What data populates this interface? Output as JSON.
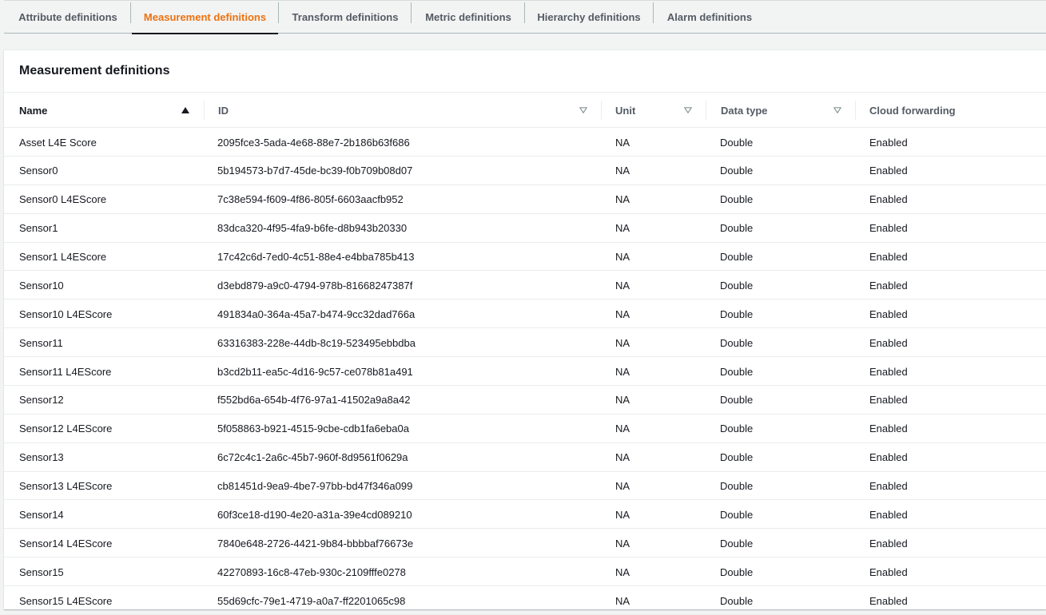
{
  "tabs": [
    {
      "label": "Attribute definitions",
      "active": false
    },
    {
      "label": "Measurement definitions",
      "active": true
    },
    {
      "label": "Transform definitions",
      "active": false
    },
    {
      "label": "Metric definitions",
      "active": false
    },
    {
      "label": "Hierarchy definitions",
      "active": false
    },
    {
      "label": "Alarm definitions",
      "active": false
    }
  ],
  "panel": {
    "title": "Measurement definitions"
  },
  "table": {
    "columns": {
      "name": "Name",
      "id": "ID",
      "unit": "Unit",
      "data_type": "Data type",
      "cloud_forwarding": "Cloud forwarding"
    },
    "sort": {
      "column": "name",
      "direction": "ascending"
    },
    "rows": [
      {
        "name": "Asset L4E Score",
        "id": "2095fce3-5ada-4e68-88e7-2b186b63f686",
        "unit": "NA",
        "data_type": "Double",
        "cloud_forwarding": "Enabled"
      },
      {
        "name": "Sensor0",
        "id": "5b194573-b7d7-45de-bc39-f0b709b08d07",
        "unit": "NA",
        "data_type": "Double",
        "cloud_forwarding": "Enabled"
      },
      {
        "name": "Sensor0 L4EScore",
        "id": "7c38e594-f609-4f86-805f-6603aacfb952",
        "unit": "NA",
        "data_type": "Double",
        "cloud_forwarding": "Enabled"
      },
      {
        "name": "Sensor1",
        "id": "83dca320-4f95-4fa9-b6fe-d8b943b20330",
        "unit": "NA",
        "data_type": "Double",
        "cloud_forwarding": "Enabled"
      },
      {
        "name": "Sensor1 L4EScore",
        "id": "17c42c6d-7ed0-4c51-88e4-e4bba785b413",
        "unit": "NA",
        "data_type": "Double",
        "cloud_forwarding": "Enabled"
      },
      {
        "name": "Sensor10",
        "id": "d3ebd879-a9c0-4794-978b-81668247387f",
        "unit": "NA",
        "data_type": "Double",
        "cloud_forwarding": "Enabled"
      },
      {
        "name": "Sensor10 L4EScore",
        "id": "491834a0-364a-45a7-b474-9cc32dad766a",
        "unit": "NA",
        "data_type": "Double",
        "cloud_forwarding": "Enabled"
      },
      {
        "name": "Sensor11",
        "id": "63316383-228e-44db-8c19-523495ebbdba",
        "unit": "NA",
        "data_type": "Double",
        "cloud_forwarding": "Enabled"
      },
      {
        "name": "Sensor11 L4EScore",
        "id": "b3cd2b11-ea5c-4d16-9c57-ce078b81a491",
        "unit": "NA",
        "data_type": "Double",
        "cloud_forwarding": "Enabled"
      },
      {
        "name": "Sensor12",
        "id": "f552bd6a-654b-4f76-97a1-41502a9a8a42",
        "unit": "NA",
        "data_type": "Double",
        "cloud_forwarding": "Enabled"
      },
      {
        "name": "Sensor12 L4EScore",
        "id": "5f058863-b921-4515-9cbe-cdb1fa6eba0a",
        "unit": "NA",
        "data_type": "Double",
        "cloud_forwarding": "Enabled"
      },
      {
        "name": "Sensor13",
        "id": "6c72c4c1-2a6c-45b7-960f-8d9561f0629a",
        "unit": "NA",
        "data_type": "Double",
        "cloud_forwarding": "Enabled"
      },
      {
        "name": "Sensor13 L4EScore",
        "id": "cb81451d-9ea9-4be7-97bb-bd47f346a099",
        "unit": "NA",
        "data_type": "Double",
        "cloud_forwarding": "Enabled"
      },
      {
        "name": "Sensor14",
        "id": "60f3ce18-d190-4e20-a31a-39e4cd089210",
        "unit": "NA",
        "data_type": "Double",
        "cloud_forwarding": "Enabled"
      },
      {
        "name": "Sensor14 L4EScore",
        "id": "7840e648-2726-4421-9b84-bbbbaf76673e",
        "unit": "NA",
        "data_type": "Double",
        "cloud_forwarding": "Enabled"
      },
      {
        "name": "Sensor15",
        "id": "42270893-16c8-47eb-930c-2109fffe0278",
        "unit": "NA",
        "data_type": "Double",
        "cloud_forwarding": "Enabled"
      },
      {
        "name": "Sensor15 L4EScore",
        "id": "55d69cfc-79e1-4719-a0a7-ff2201065c98",
        "unit": "NA",
        "data_type": "Double",
        "cloud_forwarding": "Enabled"
      }
    ]
  }
}
